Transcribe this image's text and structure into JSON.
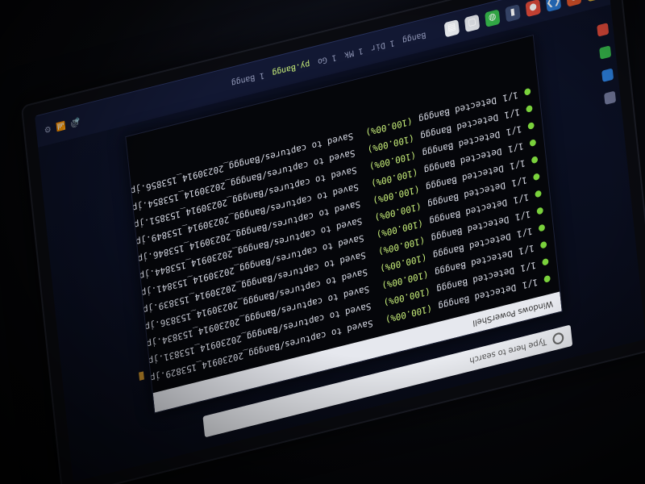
{
  "taskbar": {
    "apps": [
      {
        "name": "file-explorer-icon",
        "color": "#e2b33a",
        "glyph": "▰"
      },
      {
        "name": "firefox-icon",
        "color": "#e6572b",
        "glyph": "◉"
      },
      {
        "name": "vscode-icon",
        "color": "#2a7bd6",
        "glyph": "❮❯"
      },
      {
        "name": "chrome-icon",
        "color": "#e14a3a",
        "glyph": "●"
      },
      {
        "name": "terminal-icon",
        "color": "#3a4a70",
        "glyph": "▮"
      },
      {
        "name": "spotify-icon",
        "color": "#35b54a",
        "glyph": "◍"
      },
      {
        "name": "store-icon",
        "color": "#dde0e6",
        "glyph": "▢"
      },
      {
        "name": "word-icon",
        "color": "#e3e6ea",
        "glyph": "▤"
      }
    ],
    "tabs": [
      {
        "label": "Bangg",
        "active": false
      },
      {
        "label": "1 Dir",
        "active": false
      },
      {
        "label": "1 Mk",
        "active": false
      },
      {
        "label": "1 Go",
        "active": false
      },
      {
        "label": "py.Bangg",
        "active": true
      },
      {
        "label": "1 Bangg",
        "active": false
      }
    ],
    "sys": [
      "🔊",
      "📶",
      "⚙"
    ]
  },
  "terminal": {
    "title": "Windows PowerShell",
    "lines": [
      {
        "prefix": "1/1",
        "text": "Detected Banggg",
        "pct": "(100.00%)",
        "rest": "Saved to captures/Banggg_20230914_153829.jpg"
      },
      {
        "prefix": "1/1",
        "text": "Detected Banggg",
        "pct": "(100.00%)",
        "rest": "Saved to captures/Banggg_20230914_153831.jpg"
      },
      {
        "prefix": "1/1",
        "text": "Detected Banggg",
        "pct": "(100.00%)",
        "rest": "Saved to captures/Banggg_20230914_153834.jpg"
      },
      {
        "prefix": "1/1",
        "text": "Detected Banggg",
        "pct": "(100.00%)",
        "rest": "Saved to captures/Banggg_20230914_153836.jpg"
      },
      {
        "prefix": "1/1",
        "text": "Detected Banggg",
        "pct": "(100.00%)",
        "rest": "Saved to captures/Banggg_20230914_153839.jpg"
      },
      {
        "prefix": "1/1",
        "text": "Detected Banggg",
        "pct": "(100.00%)",
        "rest": "Saved to captures/Banggg_20230914_153841.jpg"
      },
      {
        "prefix": "1/1",
        "text": "Detected Banggg",
        "pct": "(100.00%)",
        "rest": "Saved to captures/Banggg_20230914_153844.jpg"
      },
      {
        "prefix": "1/1",
        "text": "Detected Banggg",
        "pct": "(100.00%)",
        "rest": "Saved to captures/Banggg_20230914_153846.jpg"
      },
      {
        "prefix": "1/1",
        "text": "Detected Banggg",
        "pct": "(100.00%)",
        "rest": "Saved to captures/Banggg_20230914_153849.jpg"
      },
      {
        "prefix": "1/1",
        "text": "Detected Banggg",
        "pct": "(100.00%)",
        "rest": "Saved to captures/Banggg_20230914_153851.jpg"
      },
      {
        "prefix": "1/1",
        "text": "Detected Banggg",
        "pct": "(100.00%)",
        "rest": "Saved to captures/Banggg_20230914_153854.jpg"
      },
      {
        "prefix": "1/1",
        "text": "Detected Banggg",
        "pct": "(100.00%)",
        "rest": "Saved to captures/Banggg_20230914_153856.jpg"
      }
    ]
  },
  "search": {
    "placeholder": "Type here to search"
  },
  "colors": {
    "accent_green": "#7ad13c",
    "terminal_bg": "#05060a",
    "screen_bg": "#0c1126"
  }
}
